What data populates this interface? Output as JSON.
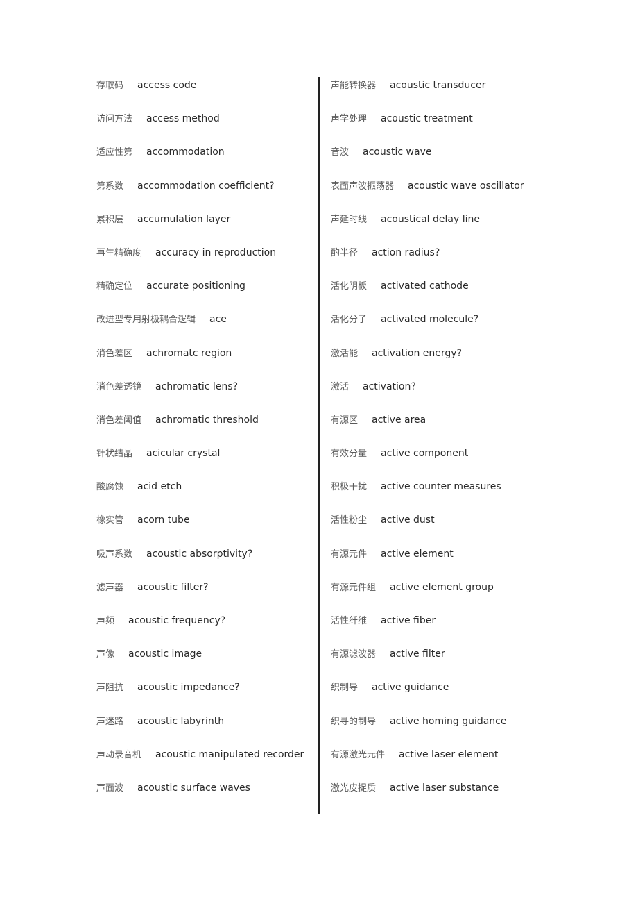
{
  "left_column": [
    {
      "zh": "存取码",
      "en": "access code"
    },
    {
      "zh": "访问方法",
      "en": "access method"
    },
    {
      "zh": "适应性第",
      "en": "accommodation"
    },
    {
      "zh": "第系数",
      "en": "accommodation coefficient?"
    },
    {
      "zh": "累积层",
      "en": "accumulation layer"
    },
    {
      "zh": "再生精确度",
      "en": "accuracy in reproduction"
    },
    {
      "zh": "精确定位",
      "en": "accurate positioning"
    },
    {
      "zh": "改进型专用射极耦合逻辑",
      "en": "ace"
    },
    {
      "zh": "消色差区",
      "en": "achromatc region"
    },
    {
      "zh": "消色差透镜",
      "en": "achromatic lens?"
    },
    {
      "zh": "消色差阈值",
      "en": "achromatic threshold"
    },
    {
      "zh": "针状结晶",
      "en": "acicular crystal"
    },
    {
      "zh": "酸腐蚀",
      "en": "acid etch"
    },
    {
      "zh": "橡实管",
      "en": "acorn tube"
    },
    {
      "zh": "吸声系数",
      "en": "acoustic absorptivity?"
    },
    {
      "zh": "滤声器",
      "en": "acoustic filter?"
    },
    {
      "zh": "声频",
      "en": "acoustic frequency?"
    },
    {
      "zh": "声像",
      "en": "acoustic image"
    },
    {
      "zh": "声阻抗",
      "en": "acoustic impedance?"
    },
    {
      "zh": "声迷路",
      "en": "acoustic labyrinth"
    },
    {
      "zh": "声动录音机",
      "en": "acoustic manipulated recorder"
    },
    {
      "zh": "声面波",
      "en": "acoustic surface waves"
    }
  ],
  "right_column": [
    {
      "zh": "声能转换器",
      "en": "acoustic transducer"
    },
    {
      "zh": "声学处理",
      "en": "acoustic treatment"
    },
    {
      "zh": "音波",
      "en": "acoustic wave"
    },
    {
      "zh": "表面声波振荡器",
      "en": "acoustic wave oscillator"
    },
    {
      "zh": "声延时线",
      "en": "acoustical delay line"
    },
    {
      "zh": "酌半径",
      "en": "action radius?"
    },
    {
      "zh": "活化阴板",
      "en": "activated cathode"
    },
    {
      "zh": "活化分子",
      "en": "activated molecule?"
    },
    {
      "zh": "激活能",
      "en": "activation energy?"
    },
    {
      "zh": "激活",
      "en": "activation?"
    },
    {
      "zh": "有源区",
      "en": "active area"
    },
    {
      "zh": "有效分量",
      "en": "active component"
    },
    {
      "zh": "积极干扰",
      "en": "active counter measures"
    },
    {
      "zh": "活性粉尘",
      "en": "active dust"
    },
    {
      "zh": "有源元件",
      "en": "active element"
    },
    {
      "zh": "有源元件组",
      "en": "active element group"
    },
    {
      "zh": "活性纤维",
      "en": "active fiber"
    },
    {
      "zh": "有源滤波器",
      "en": "active filter"
    },
    {
      "zh": "织制导",
      "en": "active guidance"
    },
    {
      "zh": "织寻的制导",
      "en": "active homing guidance"
    },
    {
      "zh": "有源激光元件",
      "en": "active laser element"
    },
    {
      "zh": "激光皮捉质",
      "en": "active laser substance"
    }
  ]
}
